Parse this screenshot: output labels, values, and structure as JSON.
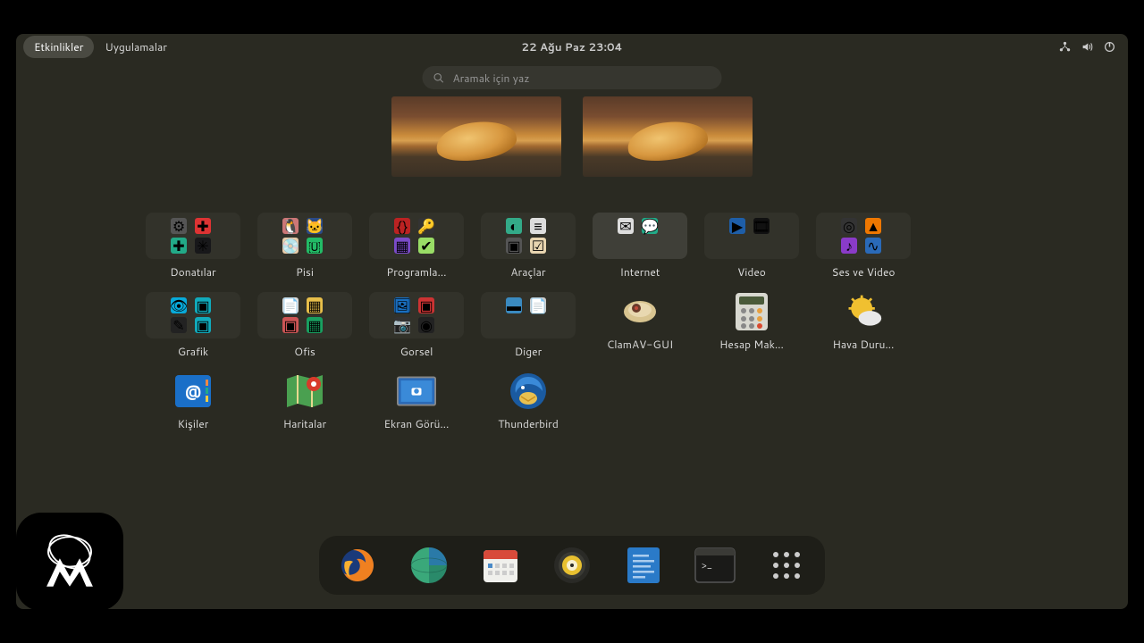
{
  "topbar": {
    "activities": "Etkinlikler",
    "applications": "Uygulamalar",
    "datetime": "22 Ağu Paz  23:04"
  },
  "search": {
    "placeholder": "Aramak için yaz"
  },
  "folders": [
    {
      "id": "donatilar",
      "label": "Donatılar"
    },
    {
      "id": "pisi",
      "label": "Pisi"
    },
    {
      "id": "programlama",
      "label": "Programla…"
    },
    {
      "id": "araclar",
      "label": "Araçlar"
    },
    {
      "id": "internet",
      "label": "Internet",
      "selected": true
    },
    {
      "id": "video",
      "label": "Video"
    },
    {
      "id": "ses-ve-video",
      "label": "Ses ve Video"
    },
    {
      "id": "grafik",
      "label": "Grafik"
    },
    {
      "id": "ofis",
      "label": "Ofis"
    },
    {
      "id": "gorsel",
      "label": "Gorsel"
    },
    {
      "id": "diger",
      "label": "Diger"
    }
  ],
  "apps": [
    {
      "id": "clamav",
      "label": "ClamAV-GUI"
    },
    {
      "id": "hesap",
      "label": "Hesap Mak…"
    },
    {
      "id": "hava",
      "label": "Hava Duru…"
    },
    {
      "id": "kisiler",
      "label": "Kişiler"
    },
    {
      "id": "haritalar",
      "label": "Haritalar"
    },
    {
      "id": "ekran",
      "label": "Ekran Görü…"
    },
    {
      "id": "thunderbird",
      "label": "Thunderbird"
    }
  ],
  "dock": [
    "firefox",
    "web",
    "calendar",
    "rhythmbox",
    "texteditor",
    "terminal",
    "apps-grid"
  ]
}
